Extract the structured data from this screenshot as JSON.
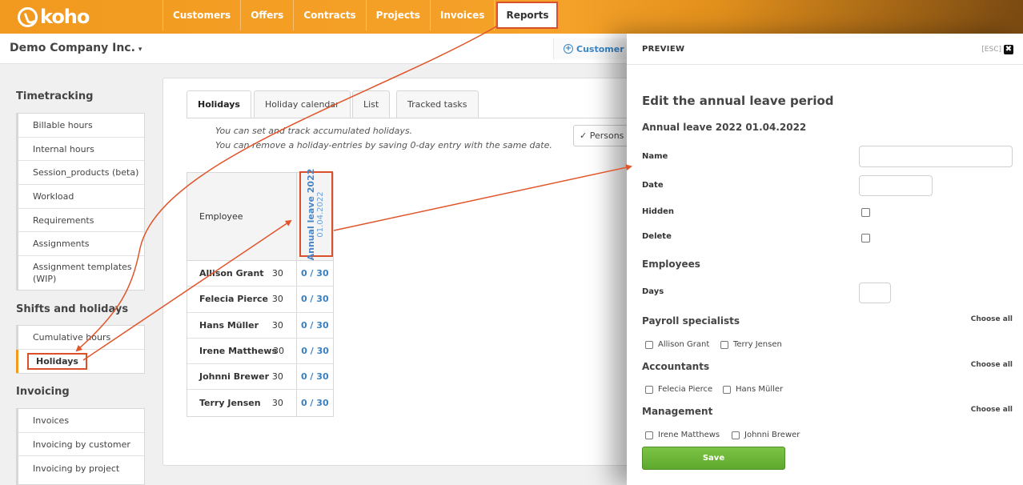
{
  "brand": {
    "name": "koho"
  },
  "nav": [
    "Customers",
    "Offers",
    "Contracts",
    "Projects",
    "Invoices",
    "Reports"
  ],
  "nav_active": "Reports",
  "company": {
    "name": "Demo Company Inc.",
    "caret": "▾"
  },
  "add_customer": {
    "plus": "+",
    "label": "Customer"
  },
  "sidebar": {
    "timetracking": {
      "heading": "Timetracking",
      "items": [
        "Billable hours",
        "Internal hours",
        "Session_products (beta)",
        "Workload",
        "Requirements",
        "Assignments",
        "Assignment templates (WIP)"
      ]
    },
    "shifts": {
      "heading": "Shifts and holidays",
      "items": [
        "Cumulative hours",
        "Holidays"
      ]
    },
    "invoicing": {
      "heading": "Invoicing",
      "items": [
        "Invoices",
        "Invoicing by customer",
        "Invoicing by project"
      ]
    }
  },
  "tabs": [
    "Holidays",
    "Holiday calendar",
    "List",
    "Tracked tasks"
  ],
  "info": {
    "line1": "You can set and track accumulated holidays.",
    "line2": "You can remove a holiday-entries by saving 0-day entry with the same date."
  },
  "persons_button": "✓ Persons",
  "grid": {
    "employee_header": "Employee",
    "period_title": "Annual leave 2022",
    "period_date": "01.04.2022",
    "rows": [
      {
        "name": "Allison Grant",
        "quota": "30",
        "value": "0 / 30"
      },
      {
        "name": "Felecia Pierce",
        "quota": "30",
        "value": "0 / 30"
      },
      {
        "name": "Hans Müller",
        "quota": "30",
        "value": "0 / 30"
      },
      {
        "name": "Irene Matthews",
        "quota": "30",
        "value": "0 / 30"
      },
      {
        "name": "Johnni Brewer",
        "quota": "30",
        "value": "0 / 30"
      },
      {
        "name": "Terry Jensen",
        "quota": "30",
        "value": "0 / 30"
      }
    ]
  },
  "preview": {
    "title": "PREVIEW",
    "esc": "[ESC]",
    "close": "✖",
    "heading": "Edit the annual leave period",
    "subheading": "Annual leave 2022 01.04.2022",
    "labels": {
      "name": "Name",
      "date": "Date",
      "hidden": "Hidden",
      "delete": "Delete",
      "days": "Days"
    },
    "employees_heading": "Employees",
    "choose_all": "Choose all",
    "groups": [
      {
        "name": "Payroll specialists",
        "members": [
          "Allison Grant",
          "Terry Jensen"
        ]
      },
      {
        "name": "Accountants",
        "members": [
          "Felecia Pierce",
          "Hans Müller"
        ]
      },
      {
        "name": "Management",
        "members": [
          "Irene Matthews",
          "Johnni Brewer"
        ]
      }
    ],
    "save": "Save"
  },
  "colors": {
    "brand_orange": "#f29a1f",
    "highlight_red": "#d9502a",
    "link_blue": "#3a87c8",
    "save_green": "#6cb73a"
  }
}
